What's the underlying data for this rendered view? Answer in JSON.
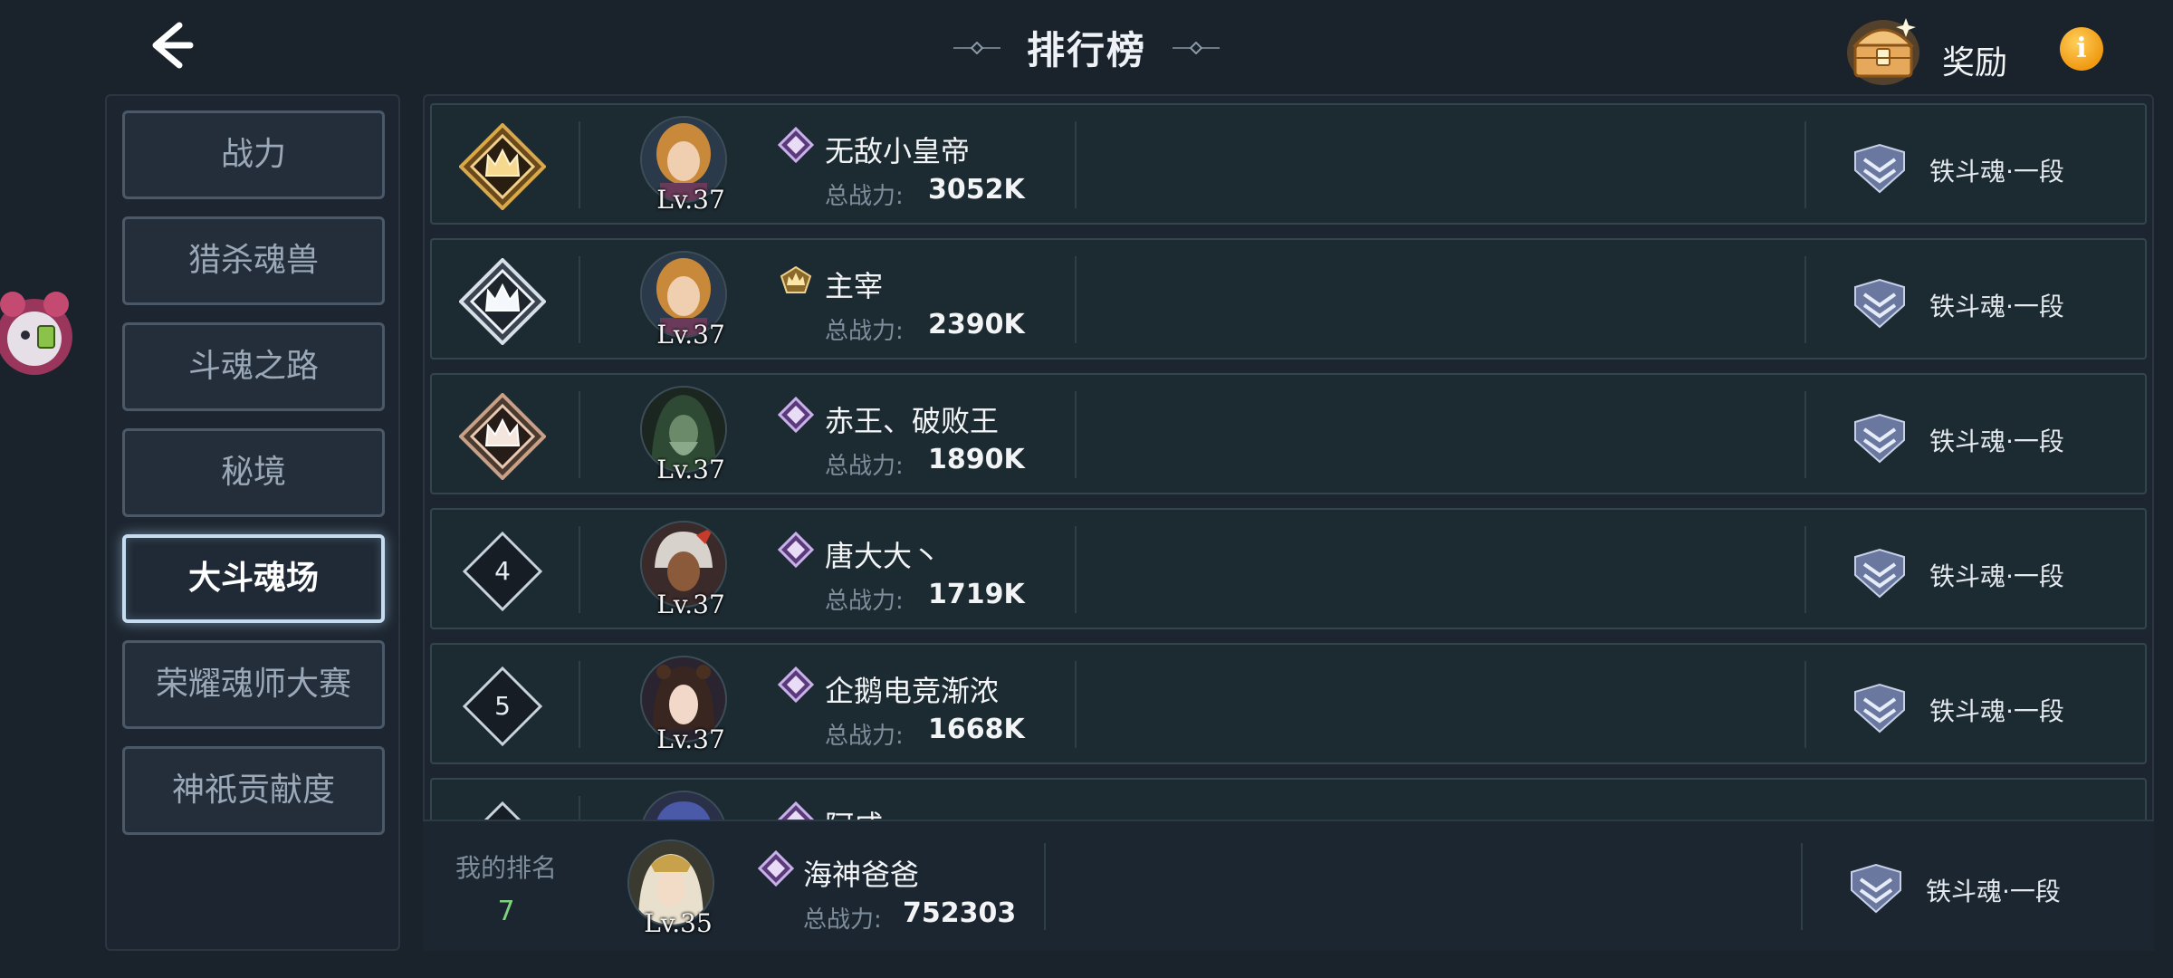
{
  "header": {
    "title": "排行榜",
    "reward_label": "奖励",
    "info_symbol": "i"
  },
  "sidebar": {
    "items": [
      {
        "label": "战力",
        "active": false
      },
      {
        "label": "猎杀魂兽",
        "active": false
      },
      {
        "label": "斗魂之路",
        "active": false
      },
      {
        "label": "秘境",
        "active": false
      },
      {
        "label": "大斗魂场",
        "active": true
      },
      {
        "label": "荣耀魂师大赛",
        "active": false
      },
      {
        "label": "神祇贡献度",
        "active": false
      }
    ]
  },
  "ranking": {
    "power_label": "总战力:",
    "rows": [
      {
        "rank": "1",
        "badge": "gold-crown",
        "level": "Lv.37",
        "tier_icon": "purple-diamond",
        "name": "无敌小皇帝",
        "power": "3052K",
        "tier_text": "铁斗魂·一段"
      },
      {
        "rank": "2",
        "badge": "silver-crown",
        "level": "Lv.37",
        "tier_icon": "gold-crown-small",
        "name": "主宰",
        "power": "2390K",
        "tier_text": "铁斗魂·一段"
      },
      {
        "rank": "3",
        "badge": "bronze-crown",
        "level": "Lv.37",
        "tier_icon": "purple-diamond",
        "name": "赤王、破败王",
        "power": "1890K",
        "tier_text": "铁斗魂·一段"
      },
      {
        "rank": "4",
        "badge": "number",
        "level": "Lv.37",
        "tier_icon": "purple-diamond",
        "name": "唐大大丶",
        "power": "1719K",
        "tier_text": "铁斗魂·一段"
      },
      {
        "rank": "5",
        "badge": "number",
        "level": "Lv.37",
        "tier_icon": "purple-diamond",
        "name": "企鹅电竞渐浓",
        "power": "1668K",
        "tier_text": "铁斗魂·一段"
      },
      {
        "rank": "",
        "badge": "number",
        "level": "",
        "tier_icon": "purple-diamond",
        "name": "阿咸",
        "power": "",
        "tier_text": ""
      }
    ]
  },
  "my_rank": {
    "label": "我的排名",
    "value": "7",
    "level": "Lv.35",
    "name": "海神爸爸",
    "power_label": "总战力:",
    "power": "752303",
    "tier_text": "铁斗魂·一段"
  },
  "colors": {
    "background": "#1a222b",
    "active_border": "#c6dcf0",
    "my_rank_value": "#7ed37e",
    "info": "#f09a12"
  }
}
